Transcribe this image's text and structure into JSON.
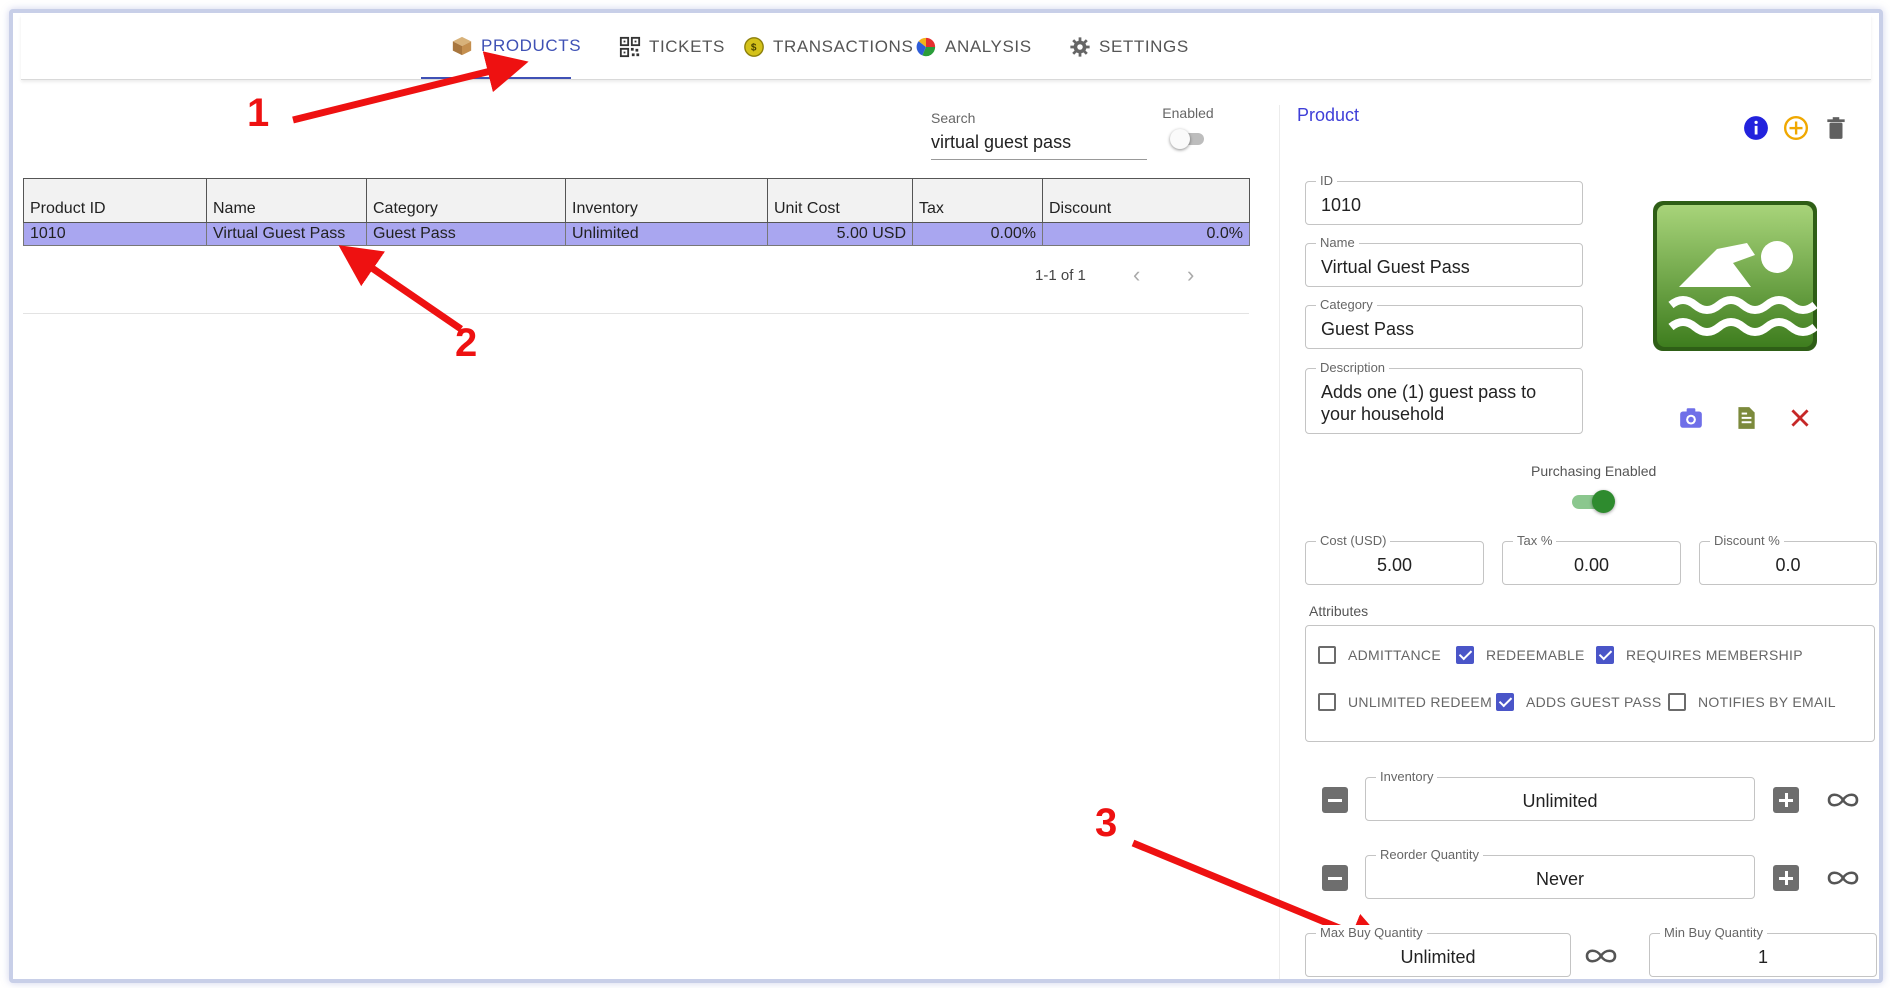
{
  "nav": {
    "tabs": [
      {
        "label": "PRODUCTS",
        "icon": "package-icon"
      },
      {
        "label": "TICKETS",
        "icon": "qr-code-icon"
      },
      {
        "label": "TRANSACTIONS",
        "icon": "coin-icon"
      },
      {
        "label": "ANALYSIS",
        "icon": "pie-chart-icon"
      },
      {
        "label": "SETTINGS",
        "icon": "gear-icon"
      }
    ],
    "active": "PRODUCTS"
  },
  "search": {
    "label": "Search",
    "value": "virtual guest pass"
  },
  "enabled": {
    "label": "Enabled",
    "on": false
  },
  "table": {
    "columns": [
      "Product ID",
      "Name",
      "Category",
      "Inventory",
      "Unit Cost",
      "Tax",
      "Discount"
    ],
    "rows": [
      [
        "1010",
        "Virtual Guest Pass",
        "Guest Pass",
        "Unlimited",
        "5.00 USD",
        "0.00%",
        "0.0%"
      ]
    ],
    "selected_row": 0
  },
  "pager": {
    "text": "1-1 of 1",
    "prev": "‹",
    "next": "›"
  },
  "annotations": {
    "a1": "1",
    "a2": "2",
    "a3": "3"
  },
  "product": {
    "title": "Product",
    "id": {
      "label": "ID",
      "value": "1010"
    },
    "name": {
      "label": "Name",
      "value": "Virtual Guest Pass"
    },
    "category": {
      "label": "Category",
      "value": "Guest Pass"
    },
    "description": {
      "label": "Description",
      "value": "Adds one (1) guest pass to your household"
    },
    "purchasing_enabled": {
      "label": "Purchasing Enabled",
      "on": true
    },
    "cost": {
      "label": "Cost (USD)",
      "value": "5.00"
    },
    "tax": {
      "label": "Tax %",
      "value": "0.00"
    },
    "discount": {
      "label": "Discount %",
      "value": "0.0"
    },
    "attributes": {
      "label": "Attributes",
      "items": [
        {
          "label": "ADMITTANCE",
          "checked": false
        },
        {
          "label": "REDEEMABLE",
          "checked": true
        },
        {
          "label": "REQUIRES MEMBERSHIP",
          "checked": true
        },
        {
          "label": "UNLIMITED REDEEM",
          "checked": false
        },
        {
          "label": "ADDS GUEST PASS",
          "checked": true
        },
        {
          "label": "NOTIFIES BY EMAIL",
          "checked": false
        }
      ]
    },
    "inventory": {
      "label": "Inventory",
      "value": "Unlimited"
    },
    "reorder": {
      "label": "Reorder Quantity",
      "value": "Never"
    },
    "max_buy": {
      "label": "Max Buy Quantity",
      "value": "Unlimited"
    },
    "min_buy": {
      "label": "Min Buy Quantity",
      "value": "1"
    }
  },
  "colors": {
    "accent": "#3f51b5",
    "selected_row": "#a9a6f0",
    "toggle_on": "#2e8b2e",
    "checkbox": "#4a55c8",
    "annotation": "#ee1111",
    "info_icon": "#2222dd",
    "add_icon": "#f0a800",
    "close_icon": "#c62828"
  },
  "icons": {
    "product_image": "swimming-icon",
    "info": "info-icon",
    "add": "add-circle-icon",
    "delete": "trash-icon",
    "camera": "camera-icon",
    "document": "document-icon",
    "close": "close-icon",
    "minus": "minus-icon",
    "plus": "plus-icon",
    "infinity": "infinity-icon"
  }
}
